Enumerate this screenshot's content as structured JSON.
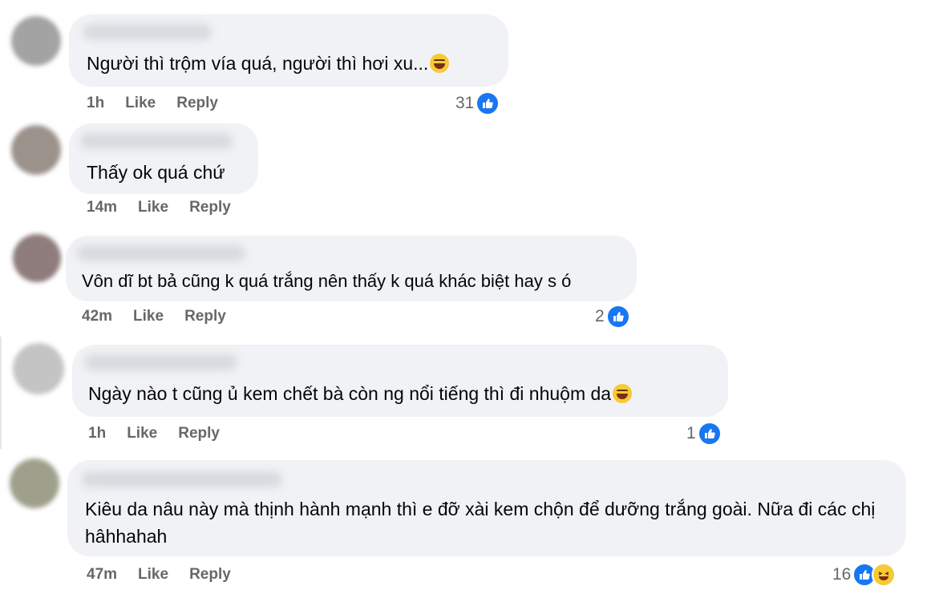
{
  "colors": {
    "bubble": "#f0f2f5",
    "meta_text": "#65676b",
    "like_blue": "#1877f2",
    "haha_yellow": "#f7c936"
  },
  "comments": [
    {
      "text": "Người thì trộm vía quá, người thì hơi xu...",
      "emoji": "grinning-squinting-emoji",
      "time": "1h",
      "like_label": "Like",
      "reply_label": "Reply",
      "reaction_count": "31",
      "reactions": [
        "like-icon"
      ]
    },
    {
      "text": "Thấy ok quá chứ",
      "time": "14m",
      "like_label": "Like",
      "reply_label": "Reply"
    },
    {
      "text": "Vôn dĩ bt bả cũng k quá trắng nên thấy k quá khác biệt hay s ó",
      "time": "42m",
      "like_label": "Like",
      "reply_label": "Reply",
      "reaction_count": "2",
      "reactions": [
        "like-icon"
      ]
    },
    {
      "text": "Ngày nào t cũng ủ kem chết bà còn ng nổi tiếng thì đi nhuộm da",
      "emoji": "tears-of-joy-emoji",
      "time": "1h",
      "like_label": "Like",
      "reply_label": "Reply",
      "reaction_count": "1",
      "reactions": [
        "like-icon"
      ]
    },
    {
      "text": "Kiêu da nâu này mà thịnh hành mạnh thì e đỡ xài kem chộn để dưỡng trắng goài. Nữa đi các chị hâhhahah",
      "time": "47m",
      "like_label": "Like",
      "reply_label": "Reply",
      "reaction_count": "16",
      "reactions": [
        "like-icon",
        "haha-icon"
      ]
    }
  ]
}
